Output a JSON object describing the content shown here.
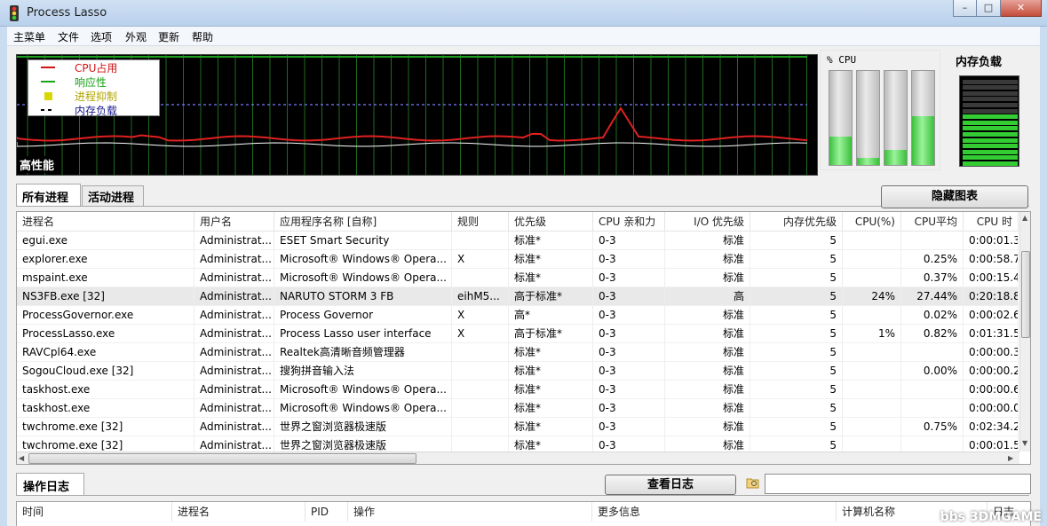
{
  "window": {
    "title": "Process Lasso",
    "buttons": [
      "–",
      "□",
      "✕"
    ]
  },
  "menu": [
    "主菜单",
    "文件",
    "选项",
    "外观",
    "更新",
    "帮助"
  ],
  "graph": {
    "legend": [
      {
        "label": "CPU占用",
        "color": "#d01515"
      },
      {
        "label": "响应性",
        "color": "#19a319"
      },
      {
        "label": "进程抑制",
        "color": "#d8d800"
      },
      {
        "label": "内存负载",
        "color": "#1a1a8c"
      }
    ],
    "mode_label": "高性能"
  },
  "cpu_panel": {
    "title": "% CPU",
    "cores_fraction": [
      0.3,
      0.08,
      0.16,
      0.52
    ]
  },
  "memory": {
    "title": "内存负载",
    "fraction": 0.62,
    "color": "#33cc33"
  },
  "tabs": [
    "所有进程",
    "活动进程"
  ],
  "hide_graph_button": "隐藏图表",
  "table": {
    "headers": [
      "进程名",
      "用户名",
      "应用程序名称 [自称]",
      "规则",
      "优先级",
      "CPU 亲和力",
      "I/O 优先级",
      "内存优先级",
      "CPU(%)",
      "CPU平均",
      "CPU 时"
    ],
    "rows": [
      [
        "egui.exe",
        "Administrat...",
        "ESET Smart Security",
        "",
        "标准*",
        "0-3",
        "标准",
        "5",
        "",
        "",
        "0:00:01.3"
      ],
      [
        "explorer.exe",
        "Administrat...",
        "Microsoft® Windows® Opera...",
        "X",
        "标准*",
        "0-3",
        "标准",
        "5",
        "",
        "0.25%",
        "0:00:58.7"
      ],
      [
        "mspaint.exe",
        "Administrat...",
        "Microsoft® Windows® Opera...",
        "",
        "标准*",
        "0-3",
        "标准",
        "5",
        "",
        "0.37%",
        "0:00:15.4"
      ],
      [
        "NS3FB.exe [32]",
        "Administrat...",
        "NARUTO STORM 3 FB",
        "eihM5...",
        "高于标准*",
        "0-3",
        "高",
        "5",
        "24%",
        "27.44%",
        "0:20:18.8"
      ],
      [
        "ProcessGovernor.exe",
        "Administrat...",
        "Process Governor",
        "X",
        "高*",
        "0-3",
        "标准",
        "5",
        "",
        "0.02%",
        "0:00:02.6"
      ],
      [
        "ProcessLasso.exe",
        "Administrat...",
        "Process Lasso user interface",
        "X",
        "高于标准*",
        "0-3",
        "标准",
        "5",
        "1%",
        "0.82%",
        "0:01:31.5"
      ],
      [
        "RAVCpl64.exe",
        "Administrat...",
        "Realtek高清晰音频管理器",
        "",
        "标准*",
        "0-3",
        "标准",
        "5",
        "",
        "",
        "0:00:00.3"
      ],
      [
        "SogouCloud.exe [32]",
        "Administrat...",
        "搜狗拼音输入法",
        "",
        "标准*",
        "0-3",
        "标准",
        "5",
        "",
        "0.00%",
        "0:00:00.2"
      ],
      [
        "taskhost.exe",
        "Administrat...",
        "Microsoft® Windows® Opera...",
        "",
        "标准*",
        "0-3",
        "标准",
        "5",
        "",
        "",
        "0:00:00.6"
      ],
      [
        "taskhost.exe",
        "Administrat...",
        "Microsoft® Windows® Opera...",
        "",
        "标准*",
        "0-3",
        "标准",
        "5",
        "",
        "",
        "0:00:00.0"
      ],
      [
        "twchrome.exe [32]",
        "Administrat...",
        "世界之窗浏览器极速版",
        "",
        "标准*",
        "0-3",
        "标准",
        "5",
        "",
        "0.75%",
        "0:02:34.2"
      ],
      [
        "twchrome.exe [32]",
        "Administrat...",
        "世界之窗浏览器极速版",
        "",
        "标准*",
        "0-3",
        "标准",
        "5",
        "",
        "",
        "0:00:01.5"
      ]
    ],
    "highlight_row": 3
  },
  "log": {
    "tab": "操作日志",
    "view_button": "查看日志",
    "search_icon": "search-folder-icon",
    "headers": [
      "时间",
      "进程名",
      "PID",
      "操作",
      "更多信息",
      "计算机名称",
      "日志"
    ]
  },
  "watermark": "bbs 3DMGAME"
}
